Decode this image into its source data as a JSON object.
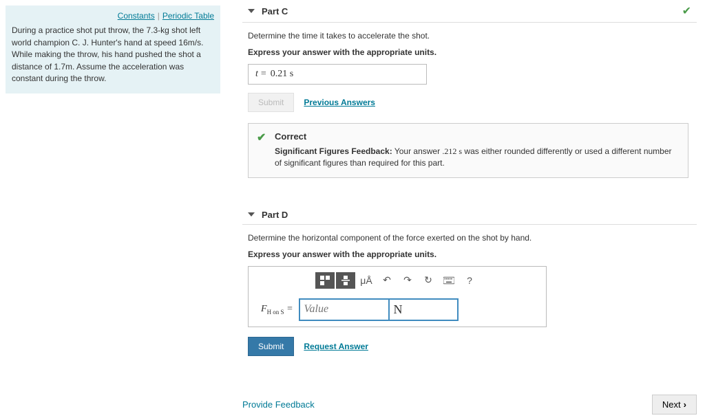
{
  "left": {
    "links": {
      "constants": "Constants",
      "periodic": "Periodic Table"
    },
    "problem": "During a practice shot put throw, the 7.3-kg shot left world champion C. J. Hunter's hand at speed 16m/s. While making the throw, his hand pushed the shot a distance of 1.7m. Assume the acceleration was constant during the throw."
  },
  "partC": {
    "title": "Part C",
    "prompt": "Determine the time it takes to accelerate the shot.",
    "express": "Express your answer with the appropriate units.",
    "var": "t",
    "equals": "=",
    "value": "0.21 s",
    "submit_disabled": "Submit",
    "prev_answers": "Previous Answers",
    "fb_title": "Correct",
    "fb_label": "Significant Figures Feedback:",
    "fb_num": ".212 s",
    "fb_text1": " Your answer ",
    "fb_text2": " was either rounded differently or used a different number of significant figures than required for this part."
  },
  "partD": {
    "title": "Part D",
    "prompt": "Determine the horizontal component of the force exerted on the shot by hand.",
    "express": "Express your answer with the appropriate units.",
    "var": "F",
    "sub": "H on S",
    "equals": "=",
    "value_placeholder": "Value",
    "unit_value": "N",
    "submit": "Submit",
    "request": "Request Answer",
    "toolbar": {
      "unit_label": "μÅ",
      "help": "?"
    }
  },
  "footer": {
    "feedback": "Provide Feedback",
    "next": "Next"
  }
}
